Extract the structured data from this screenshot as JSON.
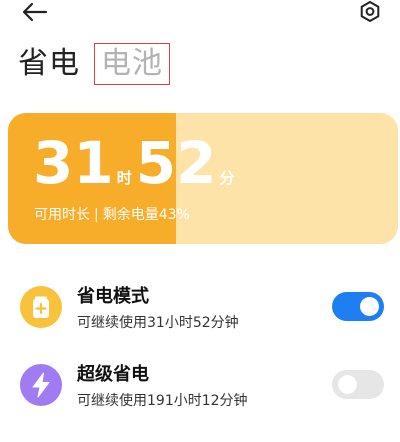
{
  "tabs": [
    {
      "label": "省电",
      "active": true
    },
    {
      "label": "电池",
      "active": false
    }
  ],
  "battery": {
    "hours": "31",
    "hours_unit": "时",
    "minutes": "52",
    "minutes_unit": "分",
    "available_label": "可用时长",
    "separator": "|",
    "remaining_label": "剩余电量43%",
    "level_fraction": 0.43,
    "fill_color": "#f7ac2a",
    "track_color": "#fde3a8"
  },
  "modes": [
    {
      "title": "省电模式",
      "desc": "可继续使用31小时52分钟",
      "icon": "battery-plus-icon",
      "icon_color": "#f9c23c",
      "enabled": true,
      "toggle_on_color": "#1d7ff2"
    },
    {
      "title": "超级省电",
      "desc": "可继续使用191小时12分钟",
      "icon": "lightning-icon",
      "icon_color": "#9f7cf2",
      "enabled": false,
      "toggle_off_color": "#e6e6e6"
    }
  ]
}
